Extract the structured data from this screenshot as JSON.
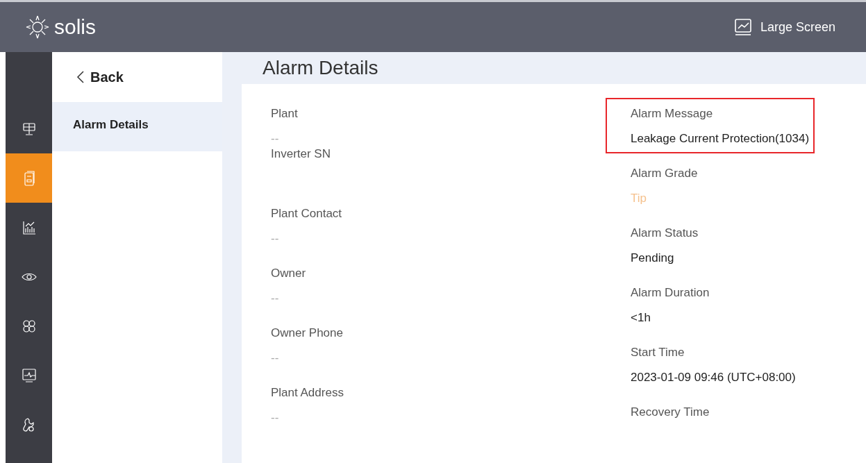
{
  "header": {
    "logo_text": "solis",
    "large_screen": "Large Screen"
  },
  "nav": [
    {
      "selected": false
    },
    {
      "selected": true
    },
    {
      "selected": false
    },
    {
      "selected": false
    },
    {
      "selected": false
    },
    {
      "selected": false
    },
    {
      "selected": false
    }
  ],
  "subnav": {
    "back": "Back",
    "items": [
      {
        "label": "Alarm Details",
        "selected": true
      }
    ]
  },
  "page_title": "Alarm Details",
  "left_fields": [
    {
      "label": "Plant",
      "value": "--",
      "kind": "muted"
    },
    {
      "label": "Inverter SN"
    },
    {
      "label": "Plant Contact",
      "value": "--",
      "kind": "muted"
    },
    {
      "label": "Owner",
      "value": "--",
      "kind": "muted"
    },
    {
      "label": "Owner Phone",
      "value": "--",
      "kind": "muted"
    },
    {
      "label": "Plant Address",
      "value": "--",
      "kind": "muted"
    }
  ],
  "right_fields": [
    {
      "label": "Alarm Message",
      "value": "Leakage Current Protection(1034)",
      "kind": "normal",
      "highlighted": true
    },
    {
      "label": "Alarm Grade",
      "value": "Tip",
      "kind": "warning",
      "highlighted": false
    },
    {
      "label": "Alarm Status",
      "value": "Pending",
      "kind": "normal",
      "highlighted": false
    },
    {
      "label": "Alarm Duration",
      "value": "<1h",
      "kind": "normal",
      "highlighted": false
    },
    {
      "label": "Start Time",
      "value": "2023-01-09 09:46 (UTC+08:00)",
      "kind": "normal",
      "highlighted": false
    },
    {
      "label": "Recovery Time",
      "highlighted": false
    }
  ]
}
